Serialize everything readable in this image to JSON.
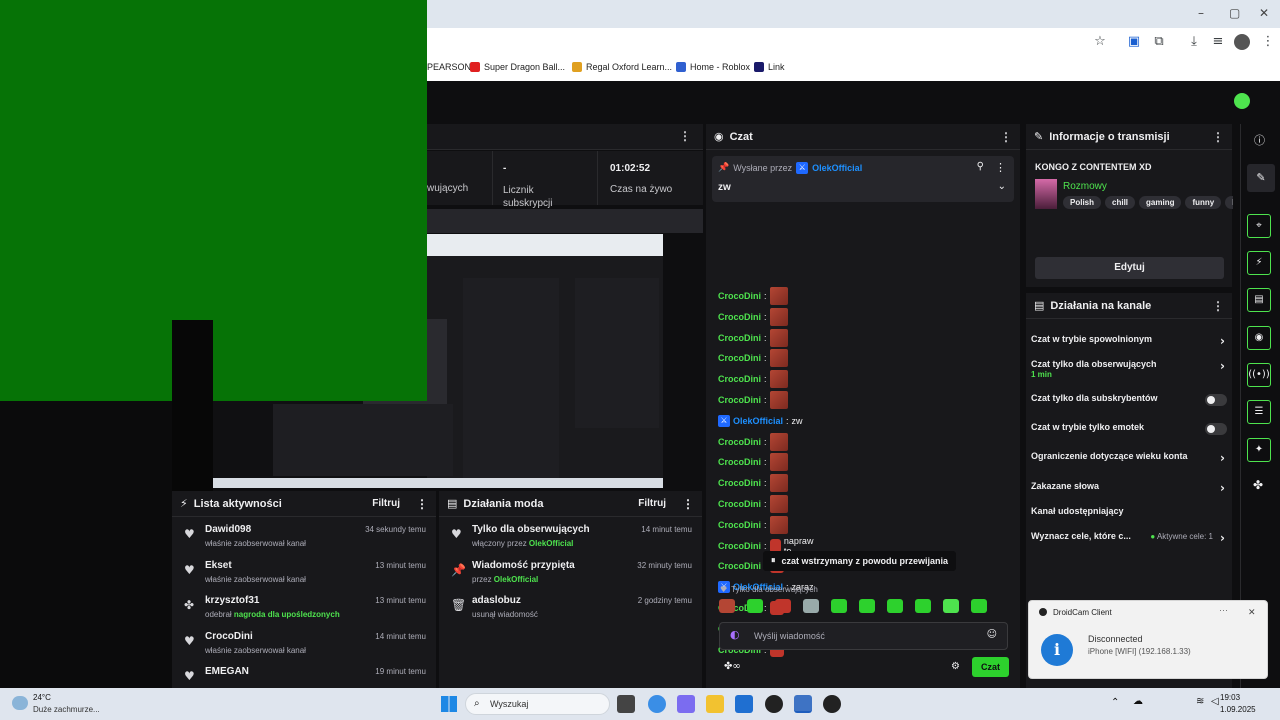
{
  "browser": {
    "bookmarks": [
      {
        "label": "PEARSON",
        "color": "#999999"
      },
      {
        "label": "Super Dragon Ball...",
        "color": "#e02020"
      },
      {
        "label": "Regal Oxford Learn...",
        "color": "#e0a020"
      },
      {
        "label": "Home - Roblox",
        "color": "#3060d0"
      },
      {
        "label": "Link",
        "color": "#1a1a6a"
      }
    ],
    "window_controls": {
      "minimize": "–",
      "maximize": "▢",
      "close": "✕"
    }
  },
  "stats": {
    "cut_label": "wujących",
    "subs_value": "-",
    "subs_label": "Licznik subskrypcji",
    "live_value": "01:02:52",
    "live_label": "Czas na żywo"
  },
  "chat": {
    "title": "Czat",
    "pinned_prefix": "Wysłane przez",
    "pinned_author": "OlekOfficial",
    "pinned_text": "zw",
    "lines": [
      {
        "nick": "CrocoDini",
        "type": "g",
        "kind": "emote",
        "text": ""
      },
      {
        "nick": "CrocoDini",
        "type": "g",
        "kind": "emote",
        "text": ""
      },
      {
        "nick": "CrocoDini",
        "type": "g",
        "kind": "emote",
        "text": ""
      },
      {
        "nick": "CrocoDini",
        "type": "g",
        "kind": "emote",
        "text": ""
      },
      {
        "nick": "CrocoDini",
        "type": "g",
        "kind": "emote",
        "text": ""
      },
      {
        "nick": "CrocoDini",
        "type": "g",
        "kind": "emote",
        "text": ""
      },
      {
        "nick": "OlekOfficial",
        "type": "b",
        "kind": "text",
        "text": "zw"
      },
      {
        "nick": "CrocoDini",
        "type": "g",
        "kind": "emote",
        "text": ""
      },
      {
        "nick": "CrocoDini",
        "type": "g",
        "kind": "emote",
        "text": ""
      },
      {
        "nick": "CrocoDini",
        "type": "g",
        "kind": "emote",
        "text": ""
      },
      {
        "nick": "CrocoDini",
        "type": "g",
        "kind": "emote",
        "text": ""
      },
      {
        "nick": "CrocoDini",
        "type": "g",
        "kind": "emote",
        "text": ""
      },
      {
        "nick": "CrocoDini",
        "type": "g",
        "kind": "face",
        "text": "napraw to"
      },
      {
        "nick": "CrocoDini",
        "type": "g",
        "kind": "face",
        "text": ""
      },
      {
        "nick": "OlekOfficial",
        "type": "b",
        "kind": "text",
        "text": "zaraz"
      },
      {
        "nick": "CrocoDini",
        "type": "g",
        "kind": "face",
        "text": ""
      },
      {
        "nick": "CrocoDini",
        "type": "g",
        "kind": "face",
        "text": ""
      },
      {
        "nick": "CrocoDini",
        "type": "g",
        "kind": "face",
        "text": ""
      }
    ],
    "paused_text": "czat wstrzymany z powodu przewijania",
    "followers_only": "Tylko dla obserwujących",
    "input_placeholder": "Wyślij wiadomość",
    "send_label": "Czat"
  },
  "info": {
    "title": "Informacje o transmisji",
    "stream_title": "KONGO Z CONTENTEM XD",
    "category": "Rozmowy",
    "tags": [
      "Polish",
      "chill",
      "gaming",
      "funny",
      "I"
    ],
    "edit_label": "Edytuj"
  },
  "channel_actions": {
    "title": "Działania na kanale",
    "rows": [
      {
        "label": "Czat w trybie spowolnionym",
        "sub": "",
        "control": "chevron"
      },
      {
        "label": "Czat tylko dla obserwujących",
        "sub": "1 min",
        "control": "chevron"
      },
      {
        "label": "Czat tylko dla subskrybentów",
        "sub": "",
        "control": "toggle"
      },
      {
        "label": "Czat w trybie tylko emotek",
        "sub": "",
        "control": "toggle"
      },
      {
        "label": "Ograniczenie dotyczące wieku konta",
        "sub": "",
        "control": "chevron"
      },
      {
        "label": "Zakazane słowa",
        "sub": "",
        "control": "chevron"
      },
      {
        "label": "Kanał udostępniający",
        "sub": "",
        "control": "none"
      },
      {
        "label": "Wyznacz cele, które c...",
        "sub": "",
        "control": "chevron"
      }
    ],
    "active_goals": "Aktywne cele: 1"
  },
  "activity": {
    "title": "Lista aktywności",
    "filter": "Filtruj",
    "items": [
      {
        "icon": "heart",
        "name": "Dawid098",
        "sub": "właśnie zaobserwował kanał",
        "hl": "",
        "time": "34 sekundy temu"
      },
      {
        "icon": "heart",
        "name": "Ekset",
        "sub": "właśnie zaobserwował kanał",
        "hl": "",
        "time": "13 minut temu"
      },
      {
        "icon": "points",
        "name": "krzysztof31",
        "sub": "odebrał",
        "hl": "nagroda dla upośledzonych",
        "time": "13 minut temu"
      },
      {
        "icon": "heart",
        "name": "CrocoDini",
        "sub": "właśnie zaobserwował kanał",
        "hl": "",
        "time": "14 minut temu"
      },
      {
        "icon": "heart",
        "name": "EMEGAN",
        "sub": "",
        "hl": "",
        "time": "19 minut temu"
      }
    ]
  },
  "mod": {
    "title": "Działania moda",
    "filter": "Filtruj",
    "items": [
      {
        "icon": "heart",
        "name": "Tylko dla obserwujących",
        "sub": "włączony przez",
        "hl": "OlekOfficial",
        "time": "14 minut temu"
      },
      {
        "icon": "pin",
        "name": "Wiadomość przypięta",
        "sub": "przez",
        "hl": "OlekOfficial",
        "time": "32 minuty temu"
      },
      {
        "icon": "trash",
        "name": "adaslobuz",
        "sub": "usunął wiadomość",
        "hl": "",
        "time": "2 godziny temu"
      }
    ]
  },
  "taskbar": {
    "weather_temp": "24°C",
    "weather_desc": "Duże zachmurze...",
    "search": "Wyszukaj",
    "time": "19:03",
    "date": "1.09.2025"
  },
  "toast": {
    "app": "DroidCam Client",
    "status": "Disconnected",
    "detail": "iPhone [WIFI] (192.168.1.33)"
  }
}
